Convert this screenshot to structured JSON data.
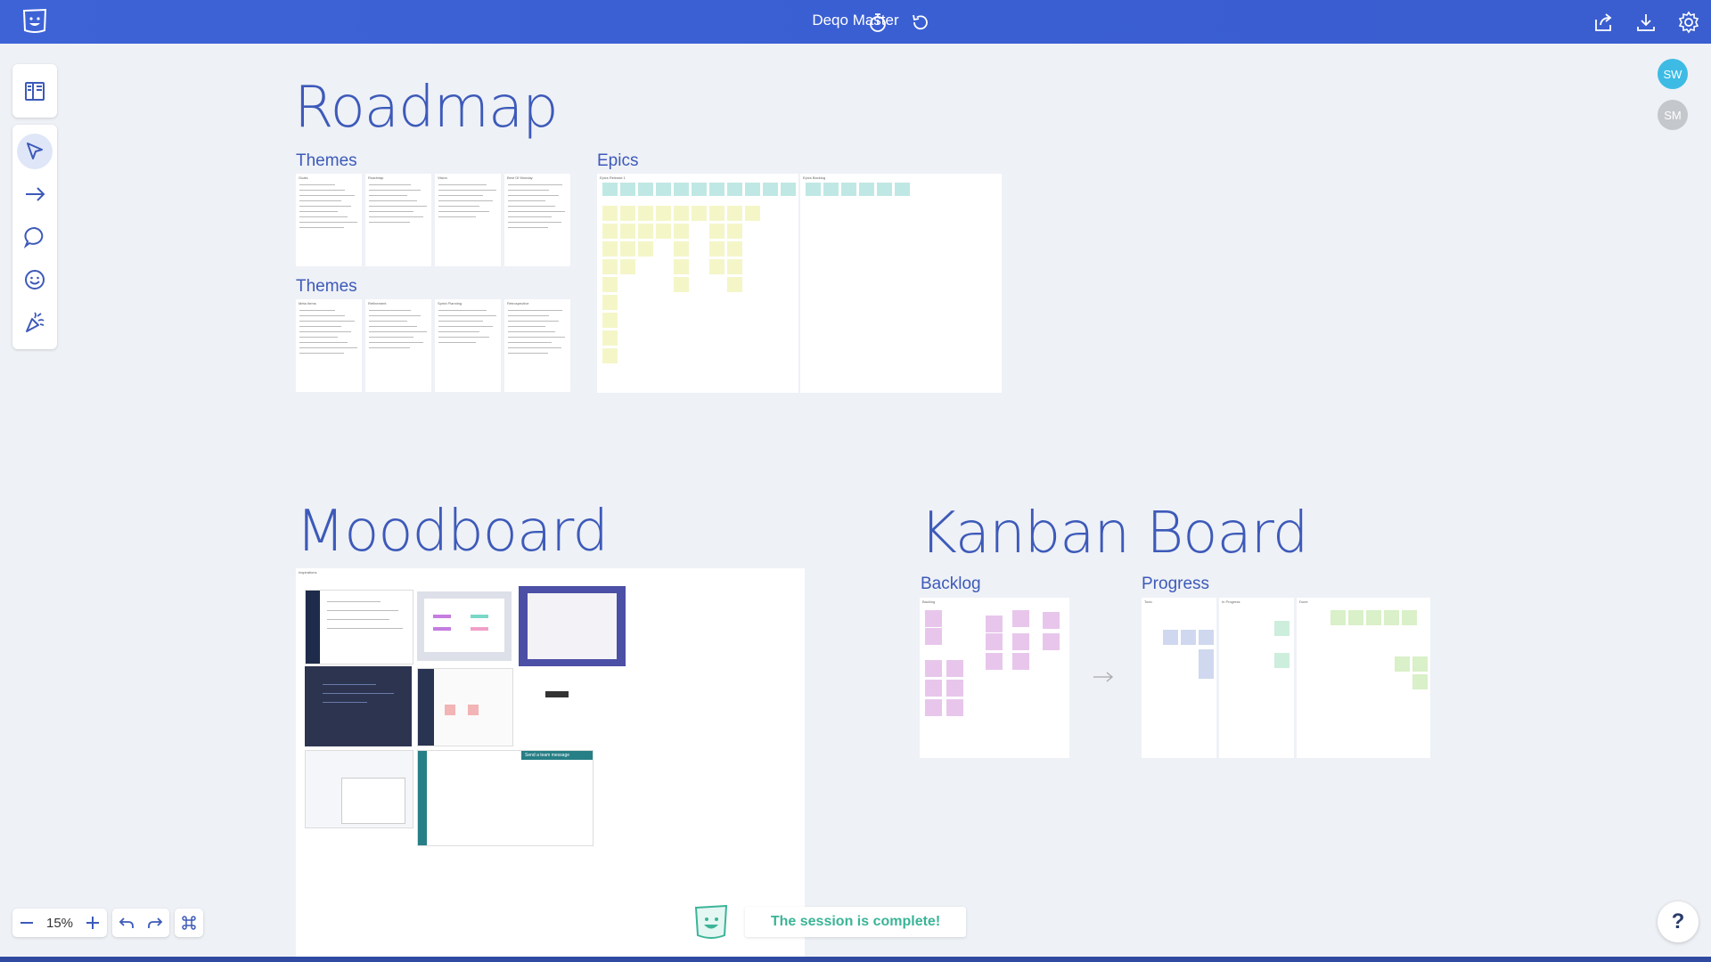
{
  "app": {
    "board_title": "Deqo Master",
    "accent_color": "#3a5fd3",
    "icons": {
      "logo": "deqo-logo-icon",
      "timer": "stopwatch-icon",
      "history": "history-icon",
      "share": "share-icon",
      "download": "download-icon",
      "settings": "gear-icon"
    }
  },
  "toolbar": {
    "tools": [
      {
        "name": "panel-toggle-icon"
      },
      {
        "name": "select-cursor-icon",
        "active": true
      },
      {
        "name": "arrow-icon"
      },
      {
        "name": "comment-icon"
      },
      {
        "name": "emoji-icon"
      },
      {
        "name": "party-popper-icon"
      }
    ]
  },
  "participants": [
    {
      "initials": "SW",
      "color": "#3dbbe4"
    },
    {
      "initials": "SM",
      "color": "#c4c7cc"
    }
  ],
  "canvas": {
    "roadmap": {
      "title": "Roadmap",
      "themes_label_1": "Themes",
      "themes_label_2": "Themes",
      "epics_label": "Epics",
      "theme_columns_1": [
        "Goals",
        "Roadmap",
        "Vision",
        "Best Of Monday"
      ],
      "theme_columns_2": [
        "Meta Items",
        "Refinement",
        "Sprint Planning",
        "Retrospective"
      ],
      "epic_frames": [
        "Epics Release 1",
        "Epics Backlog"
      ]
    },
    "moodboard": {
      "title": "Moodboard",
      "frame_label": "Inspirations",
      "mini_caption": "Send a team message"
    },
    "kanban": {
      "title": "Kanban Board",
      "backlog_label": "Backlog",
      "progress_label": "Progress",
      "backlog_frame": "Backlog",
      "progress_columns": [
        "Todo",
        "In Progress",
        "Done"
      ]
    }
  },
  "bottom": {
    "zoom": "15%",
    "toast": "The session is complete!",
    "help": "?"
  }
}
